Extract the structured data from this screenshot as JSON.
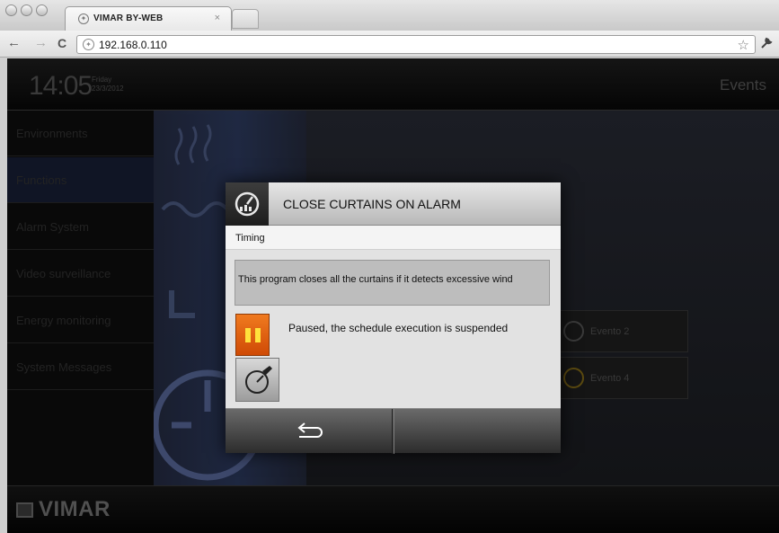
{
  "browser": {
    "tab_title": "VIMAR BY-WEB",
    "tab_close": "×",
    "url": "192.168.0.110",
    "back_glyph": "←",
    "forward_glyph": "→",
    "reload_glyph": "C",
    "star_glyph": "☆",
    "wrench_glyph": "🔧"
  },
  "header": {
    "time": "14:05",
    "day": "Friday",
    "date": "23/3/2012",
    "page_title": "Events"
  },
  "sidebar": {
    "items": [
      {
        "label": "Environments"
      },
      {
        "label": "Functions"
      },
      {
        "label": "Alarm System"
      },
      {
        "label": "Video surveillance"
      },
      {
        "label": "Energy monitoring"
      },
      {
        "label": "System Messages"
      }
    ],
    "active_index": 1
  },
  "events": [
    {
      "label": "Evento 2"
    },
    {
      "label": "Evento 4"
    }
  ],
  "dialog": {
    "title": "CLOSE CURTAINS ON ALARM",
    "subtitle": "Timing",
    "description": "This program closes all the curtains if it detects excessive wind",
    "status": "Paused, the schedule execution is suspended"
  },
  "footer": {
    "logo": "VIMAR"
  },
  "colors": {
    "pause_orange": "#e0600f",
    "pause_yellow": "#ffe23c",
    "active_item": "#101525"
  }
}
